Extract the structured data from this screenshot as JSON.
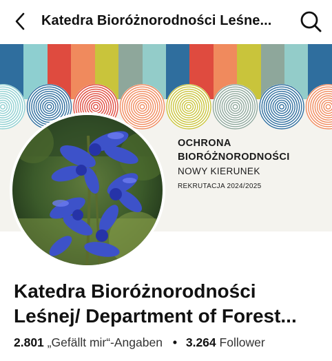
{
  "header": {
    "title": "Katedra Bioróżnorodności Leśne...",
    "back_icon": "chevron-left-icon",
    "search_icon": "search-icon"
  },
  "cover": {
    "heading_line1": "OCHRONA",
    "heading_line2": "BIORÓŻNORODNOŚCI",
    "subtitle": "NOWY KIERUNEK",
    "recruitment": "REKRUTACJA 2024/2025",
    "stripe_colors": [
      "#2f6e9e",
      "#8ecfd0",
      "#df4b3f",
      "#f08a5d",
      "#c9c43b",
      "#8ea79b",
      "#93ccc9",
      "#2f6e9e",
      "#df4b3f",
      "#f08a5d",
      "#c9c43b",
      "#8ea79b",
      "#93ccc9",
      "#2f6e9e"
    ],
    "ring_colors": [
      "#8ecfd0",
      "#2f6e9e",
      "#df4b3f",
      "#f08a5d",
      "#c9c43b",
      "#8ea79b",
      "#2f6e9e",
      "#f08a5d",
      "#8ea79b",
      "#93ccc9",
      "#2f6e9e"
    ]
  },
  "profile": {
    "name_line1": "Katedra Bioróżnorodności",
    "name_line2": "Leśnej/ Department of Forest...",
    "likes_count": "2.801",
    "likes_label": "„Gefällt mir“-Angaben",
    "separator": "•",
    "followers_count": "3.264",
    "followers_label": "Follower"
  }
}
